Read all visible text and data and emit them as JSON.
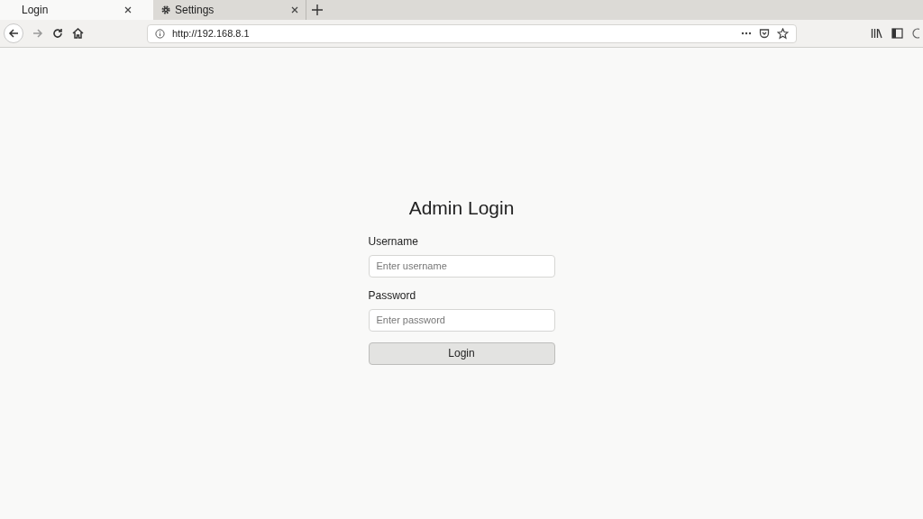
{
  "tabs": [
    {
      "label": "Login",
      "kind": "page",
      "selected": true
    },
    {
      "label": "Settings",
      "kind": "settings",
      "selected": false
    }
  ],
  "address_bar": {
    "url": "http://192.168.8.1"
  },
  "form": {
    "title": "Admin Login",
    "fields": [
      {
        "label": "Username",
        "placeholder": "Enter username"
      },
      {
        "label": "Password",
        "placeholder": "Enter password"
      }
    ],
    "button": "Login"
  }
}
